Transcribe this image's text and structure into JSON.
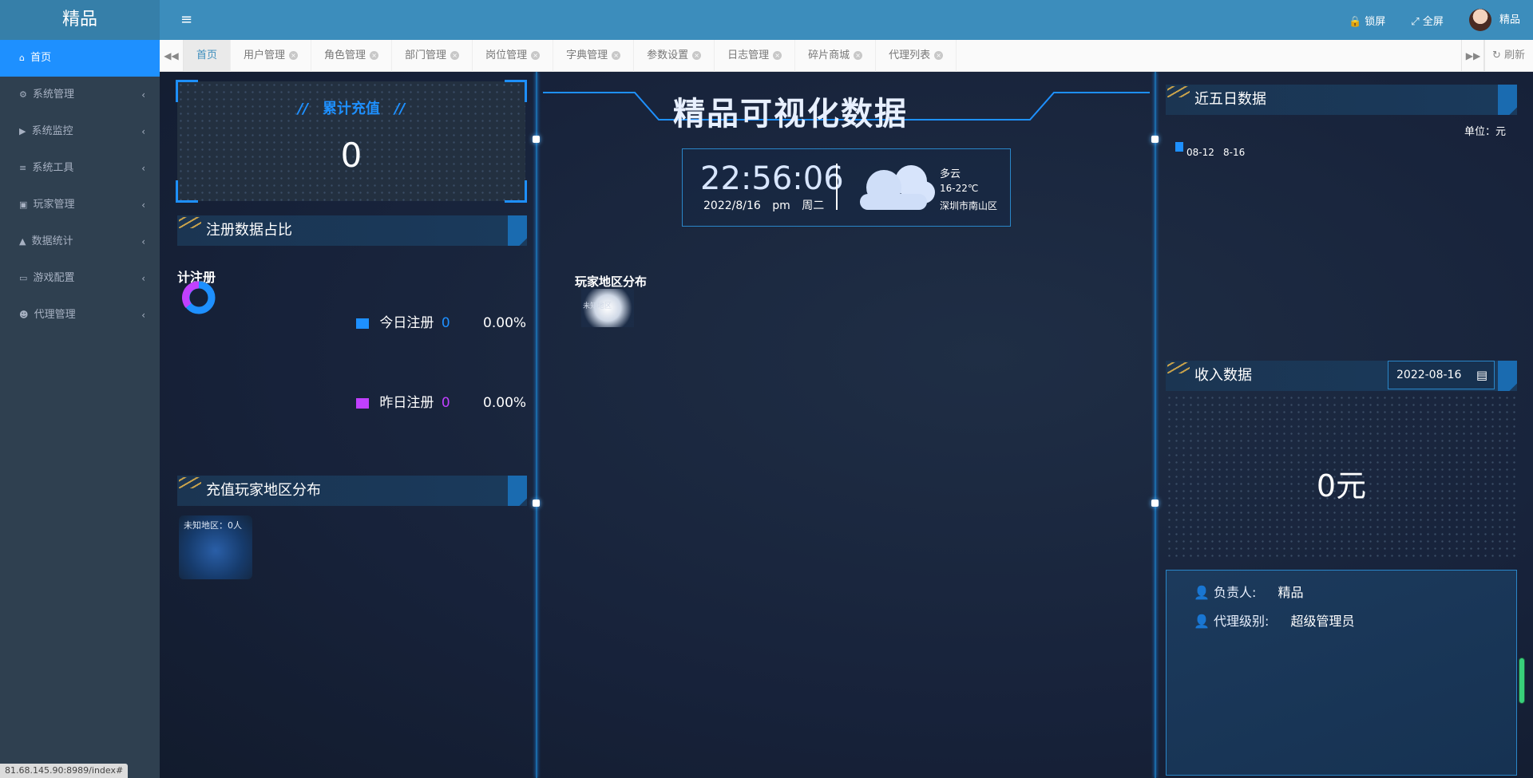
{
  "app": {
    "brand": "精品"
  },
  "sidebar": {
    "items": [
      {
        "icon": "home-icon",
        "label": "首页"
      },
      {
        "icon": "gear-icon",
        "label": "系统管理"
      },
      {
        "icon": "video-icon",
        "label": "系统监控"
      },
      {
        "icon": "list-icon",
        "label": "系统工具"
      },
      {
        "icon": "id-card-icon",
        "label": "玩家管理"
      },
      {
        "icon": "chart-icon",
        "label": "数据统计"
      },
      {
        "icon": "monitor-icon",
        "label": "游戏配置"
      },
      {
        "icon": "users-icon",
        "label": "代理管理"
      }
    ]
  },
  "topbar": {
    "lock_label": "锁屏",
    "fullscreen_label": "全屏",
    "user_name": "精品"
  },
  "tabs": {
    "items": [
      "首页",
      "用户管理",
      "角色管理",
      "部门管理",
      "岗位管理",
      "字典管理",
      "参数设置",
      "日志管理",
      "碎片商城",
      "代理列表"
    ],
    "refresh_label": "刷新"
  },
  "dashboard": {
    "title": "精品可视化数据",
    "accumulated": {
      "title": "累计充值",
      "value": "0"
    },
    "register": {
      "title": "注册数据占比",
      "donut_label": "计注册",
      "today": {
        "label": "今日注册",
        "value": "0",
        "pct": "0.00%",
        "color": "#1e90ff"
      },
      "yesterday": {
        "label": "昨日注册",
        "value": "0",
        "pct": "0.00%",
        "color": "#c040ff"
      }
    },
    "recharge_map": {
      "title": "充值玩家地区分布",
      "note": "未知地区：0人"
    },
    "player_map": {
      "title": "玩家地区分布",
      "note": "未知地区"
    },
    "clock": {
      "time": "22:56:06",
      "date": "2022/8/16",
      "ampm": "pm",
      "weekday": "周二",
      "weather": "多云",
      "temp": "16-22℃",
      "location": "深圳市南山区"
    },
    "five_days": {
      "title": "近五日数据",
      "unit": "单位：元",
      "x_start": "08-12",
      "x_end": "8-16"
    },
    "income": {
      "title": "收入数据",
      "date": "2022-08-16",
      "value": "0元"
    },
    "info": {
      "owner_label": "负责人:",
      "owner_value": "精品",
      "level_label": "代理级别:",
      "level_value": "超级管理员"
    },
    "status_url": "81.68.145.90:8989/index#"
  }
}
